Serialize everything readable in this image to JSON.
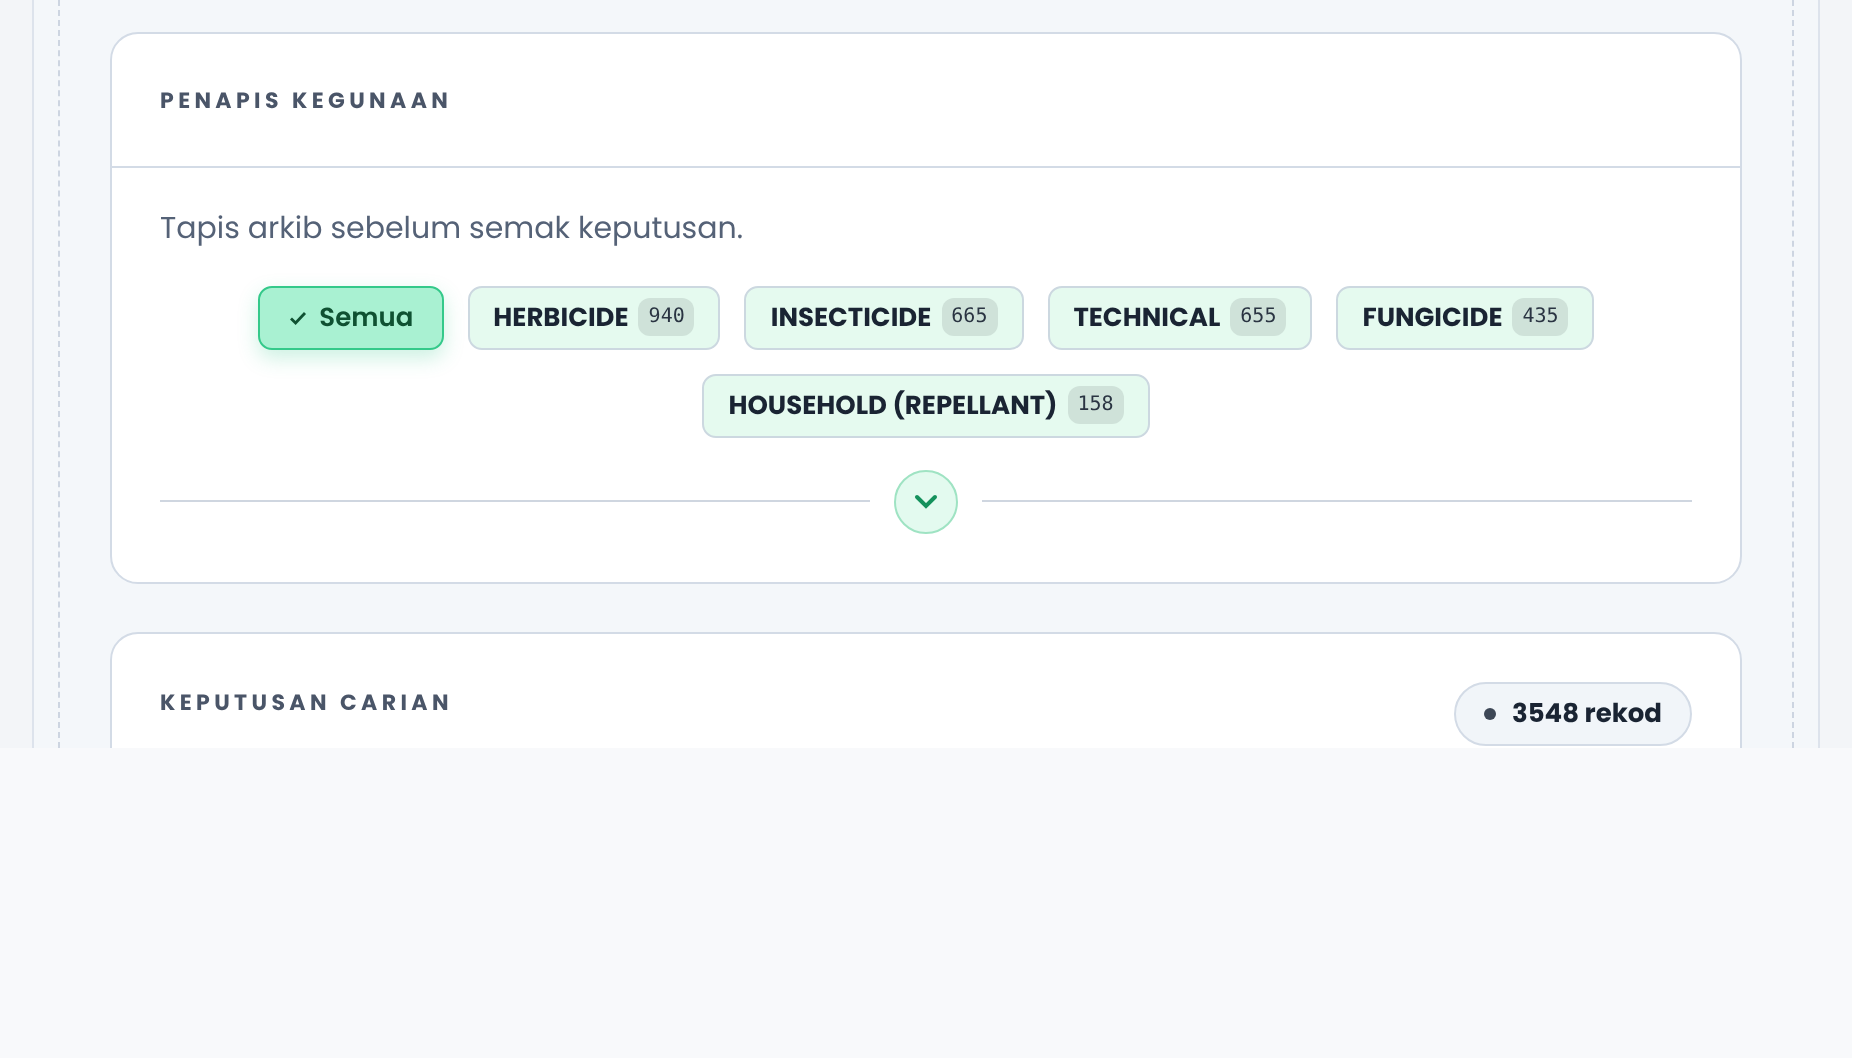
{
  "filter_card": {
    "title": "PENAPIS KEGUNAAN",
    "description": "Tapis arkib sebelum semak keputusan.",
    "chips": [
      {
        "label": "Semua",
        "selected": true
      },
      {
        "label": "HERBICIDE",
        "count": "940",
        "selected": false
      },
      {
        "label": "INSECTICIDE",
        "count": "665",
        "selected": false
      },
      {
        "label": "TECHNICAL",
        "count": "655",
        "selected": false
      },
      {
        "label": "FUNGICIDE",
        "count": "435",
        "selected": false
      },
      {
        "label": "HOUSEHOLD (REPELLANT)",
        "count": "158",
        "selected": false
      }
    ],
    "expanded": false
  },
  "results_card": {
    "title": "KEPUTUSAN CARIAN",
    "record_count": "3548 rekod"
  }
}
